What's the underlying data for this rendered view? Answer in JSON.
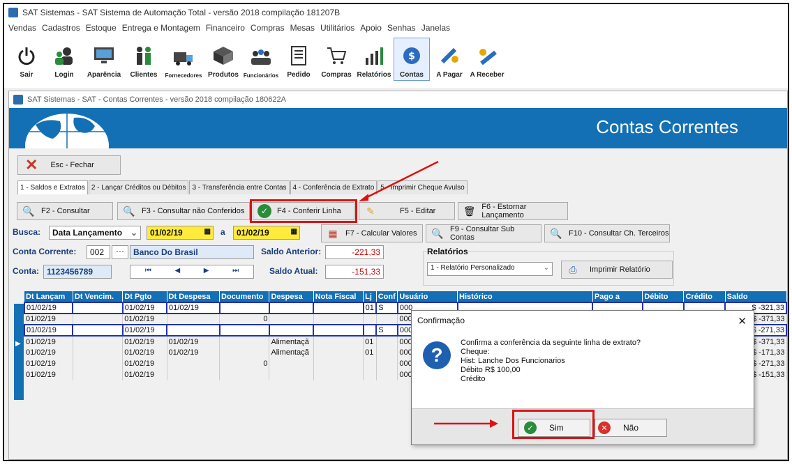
{
  "app": {
    "title": "SAT Sistemas - SAT Sistema de Automação Total - versão 2018 compilação 181207B",
    "menu": [
      "Vendas",
      "Cadastros",
      "Estoque",
      "Entrega e Montagem",
      "Financeiro",
      "Compras",
      "Mesas",
      "Utilitários",
      "Apoio",
      "Senhas",
      "Janelas"
    ]
  },
  "toolbar": [
    {
      "label": "Sair",
      "icon": "power-icon"
    },
    {
      "label": "Login",
      "icon": "users-icon"
    },
    {
      "label": "Aparência",
      "icon": "monitor-icon"
    },
    {
      "label": "Clientes",
      "icon": "clients-icon"
    },
    {
      "label": "Fornecedores",
      "icon": "truck-icon"
    },
    {
      "label": "Produtos",
      "icon": "boxes-icon"
    },
    {
      "label": "Funcionários",
      "icon": "staff-icon"
    },
    {
      "label": "Pedido",
      "icon": "order-icon"
    },
    {
      "label": "Compras",
      "icon": "cart-icon"
    },
    {
      "label": "Relatórios",
      "icon": "chart-icon"
    },
    {
      "label": "Contas",
      "icon": "accounts-icon"
    },
    {
      "label": "A Pagar",
      "icon": "pay-icon"
    },
    {
      "label": "A Receber",
      "icon": "receive-icon"
    }
  ],
  "window": {
    "title": "SAT Sistemas - SAT - Contas Correntes - versão 2018 compilação 180622A",
    "banner_title": "Contas Correntes",
    "close_label": "Esc - Fechar"
  },
  "tabs": [
    "1 - Saldos e Extratos",
    "2 - Lançar Créditos ou Débitos",
    "3 - Transferência entre Contas",
    "4 - Conferência de Extrato",
    "5 - Imprimir Cheque Avulso"
  ],
  "actions": {
    "consultar": "F2 - Consultar",
    "nao_conferidos": "F3 - Consultar não Conferidos",
    "conferir": "F4 - Conferir Linha",
    "editar": "F5 - Editar",
    "estornar": "F6 - Estornar Lançamento",
    "calcular": "F7 - Calcular Valores",
    "sub_contas": "F9 - Consultar Sub Contas",
    "terceiros": "F10 - Consultar Ch. Terceiros"
  },
  "filters": {
    "busca_label": "Busca:",
    "busca_value": "Data Lançamento",
    "date_from": "01/02/19",
    "date_sep": "a",
    "date_to": "01/02/19",
    "conta_corrente_label": "Conta Corrente:",
    "conta_corrente_code": "002",
    "bank": "Banco Do Brasil",
    "conta_label": "Conta:",
    "conta_value": "1123456789",
    "saldo_anterior_label": "Saldo Anterior:",
    "saldo_anterior": "-221,33",
    "saldo_atual_label": "Saldo Atual:",
    "saldo_atual": "-151,33",
    "relatorios_label": "Relatórios",
    "relatorio_value": "1 - Relatório Personalizado",
    "imprimir_label": "Imprimir Relatório"
  },
  "grid": {
    "columns": [
      "Dt Lançam",
      "Dt Vencim.",
      "Dt Pgto",
      "Dt Despesa",
      "Documento",
      "Despesa",
      "Nota Fiscal",
      "Lj",
      "Conf",
      "Usuário",
      "Histórico",
      "Pago a",
      "Débito",
      "Crédito",
      "Saldo"
    ],
    "rows": [
      {
        "dt": "01/02/19",
        "pgto": "01/02/19",
        "desp_dt": "01/02/19",
        "doc": "",
        "desp": "",
        "lj": "01",
        "conf": "S",
        "user": "000",
        "saldo": "$ -321,33",
        "edit": true
      },
      {
        "dt": "01/02/19",
        "pgto": "01/02/19",
        "desp_dt": "",
        "doc": "0",
        "desp": "",
        "lj": "",
        "conf": "",
        "user": "000",
        "saldo": "$ -371,33",
        "edit": false
      },
      {
        "dt": "01/02/19",
        "pgto": "01/02/19",
        "desp_dt": "",
        "doc": "",
        "desp": "",
        "lj": "",
        "conf": "S",
        "user": "000",
        "saldo": "$ -271,33",
        "edit": true
      },
      {
        "dt": "01/02/19",
        "pgto": "01/02/19",
        "desp_dt": "01/02/19",
        "doc": "",
        "desp": "Alimentaçã",
        "lj": "01",
        "conf": "",
        "user": "000",
        "saldo": "$ -371,33",
        "edit": false
      },
      {
        "dt": "01/02/19",
        "pgto": "01/02/19",
        "desp_dt": "01/02/19",
        "doc": "",
        "desp": "Alimentaçã",
        "lj": "01",
        "conf": "",
        "user": "000",
        "saldo": "$ -171,33",
        "edit": false
      },
      {
        "dt": "01/02/19",
        "pgto": "01/02/19",
        "desp_dt": "",
        "doc": "0",
        "desp": "",
        "lj": "",
        "conf": "",
        "user": "000",
        "saldo": "$ -271,33",
        "edit": false
      },
      {
        "dt": "01/02/19",
        "pgto": "01/02/19",
        "desp_dt": "",
        "doc": "",
        "desp": "",
        "lj": "",
        "conf": "",
        "user": "000",
        "saldo": "$ -151,33",
        "edit": false
      }
    ]
  },
  "dialog": {
    "title": "Confirmação",
    "line1": "Confirma a conferência da seguinte linha de extrato?",
    "line2": "Cheque:",
    "line3": "Hist: Lanche Dos Funcionarios",
    "line4": "Débito R$ 100,00",
    "line5": "Crédito",
    "yes": "Sim",
    "no": "Não"
  },
  "colors": {
    "accent": "#1370b5",
    "highlight": "#e01010",
    "date_bg": "#ffeb3b"
  }
}
